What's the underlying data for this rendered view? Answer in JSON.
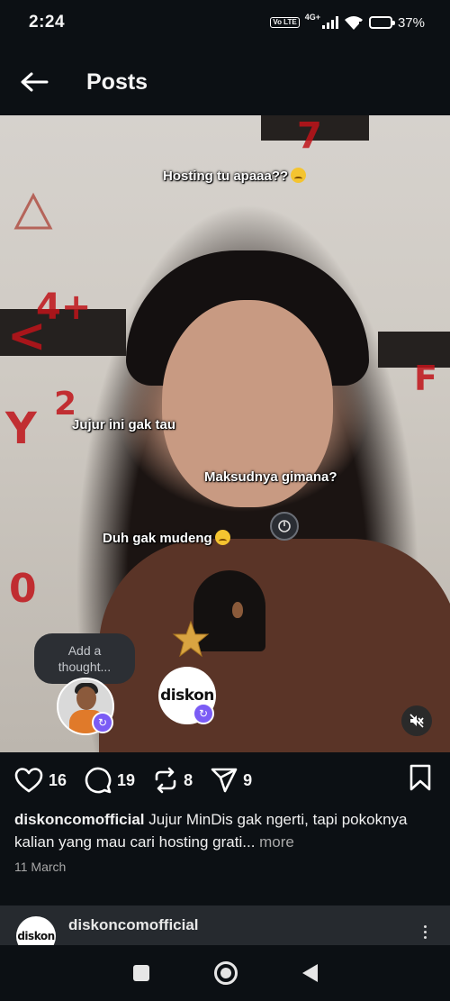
{
  "status_bar": {
    "time": "2:24",
    "volte": "Vo LTE",
    "network": "4G+",
    "battery_percent": "37%",
    "battery_level": 0.37
  },
  "header": {
    "title": "Posts"
  },
  "media": {
    "stickers": {
      "top": "Hosting tu apaaa??",
      "left": "Jujur ini gak tau",
      "right": "Maksudnya gimana?",
      "bottom": "Duh gak mudeng"
    },
    "thought_placeholder": "Add a thought...",
    "brand_avatar_text": "diskon"
  },
  "actions": {
    "likes": "16",
    "comments": "19",
    "reposts": "8",
    "shares": "9"
  },
  "caption": {
    "username": "diskoncomofficial",
    "text": " Jujur MinDis gak ngerti, tapi pokoknya kalian yang mau cari hosting grati...",
    "more": " more"
  },
  "post_date": "11 March",
  "next_post": {
    "username": "diskoncomofficial",
    "avatar_text": "diskon"
  },
  "colors": {
    "repost_badge": "#7b5cf5",
    "background": "#0c1014"
  }
}
